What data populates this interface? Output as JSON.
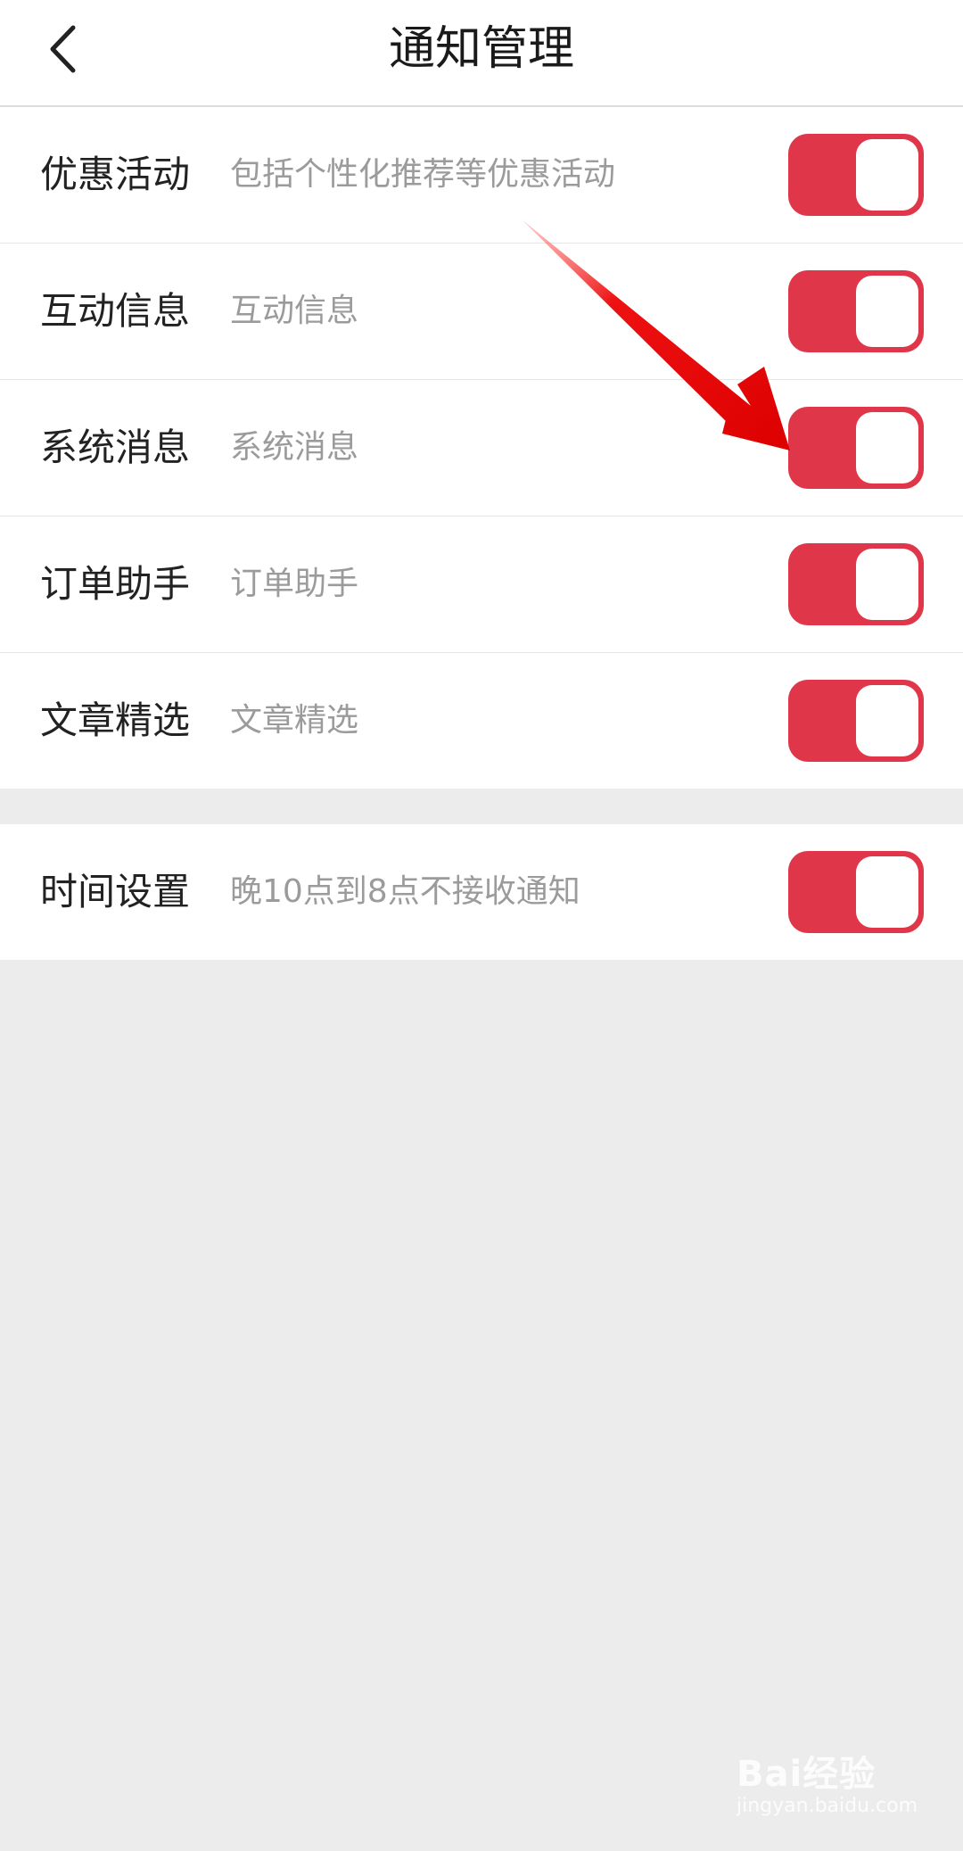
{
  "header": {
    "title": "通知管理",
    "back_icon": "chevron-left-icon"
  },
  "settings": [
    {
      "label": "优惠活动",
      "description": "包括个性化推荐等优惠活动",
      "enabled": true
    },
    {
      "label": "互动信息",
      "description": "互动信息",
      "enabled": true
    },
    {
      "label": "系统消息",
      "description": "系统消息",
      "enabled": true
    },
    {
      "label": "订单助手",
      "description": "订单助手",
      "enabled": true
    },
    {
      "label": "文章精选",
      "description": "文章精选",
      "enabled": true
    }
  ],
  "time_setting": {
    "label": "时间设置",
    "description": "晚10点到8点不接收通知",
    "enabled": true
  },
  "watermark": {
    "text": "Bai经验",
    "sub": "jingyan.baidu.com"
  },
  "colors": {
    "toggle_on": "#e0364a",
    "arrow": "#ee1111",
    "background": "#ececec"
  }
}
